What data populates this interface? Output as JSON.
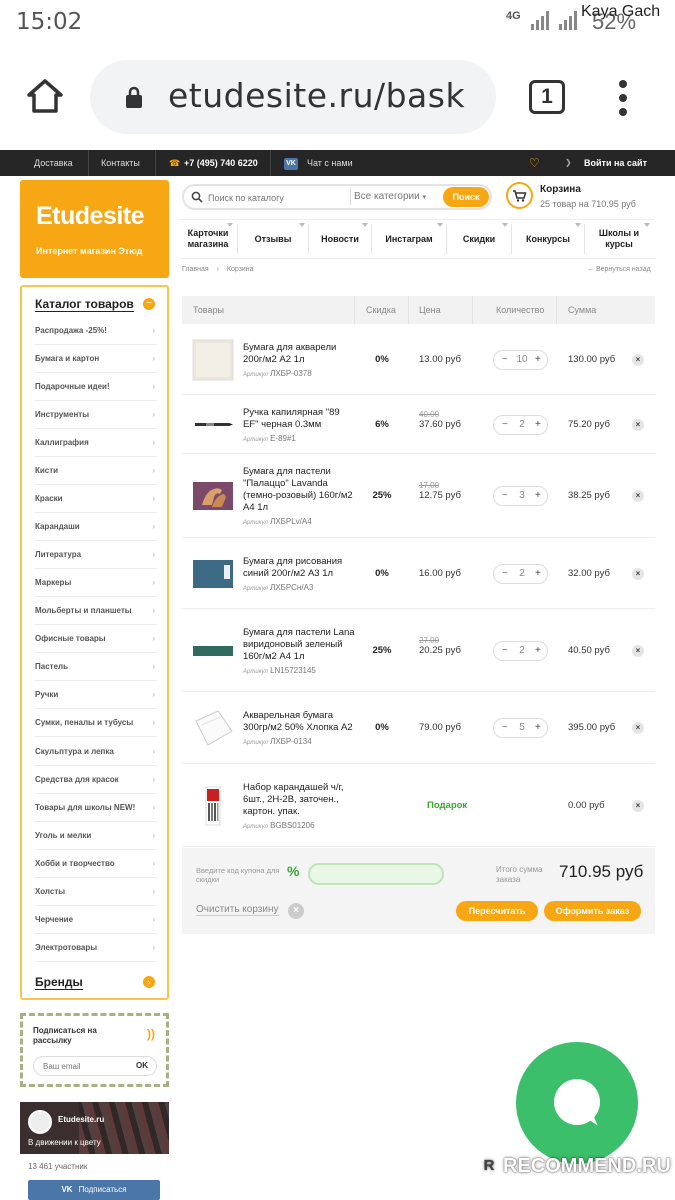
{
  "status": {
    "time": "15:02",
    "network": "4G",
    "battery": "52%",
    "watermark_user": "Kaya Gach"
  },
  "browser": {
    "url": "etudesite.ru/bask",
    "tab_count": "1"
  },
  "topbar": {
    "delivery": "Доставка",
    "contacts": "Контакты",
    "phone": "+7 (495) 740 6220",
    "vk": "VK",
    "chat": "Чат с нами",
    "login": "Войти на сайт"
  },
  "logo": {
    "brand": "Etudesite",
    "tagline": "Интернет магазин Этюд"
  },
  "search": {
    "placeholder": "Поиск по каталогу",
    "category": "Все категории",
    "button": "Поиск"
  },
  "cart": {
    "title": "Корзина",
    "summary": "25 товар на 710.95 руб"
  },
  "nav": [
    "Карточки магазина",
    "Отзывы",
    "Новости",
    "Инстаграм",
    "Скидки",
    "Конкурсы",
    "Школы и курсы"
  ],
  "breadcrumb": {
    "home": "Главная",
    "sep": "›",
    "current": "Корзина",
    "back": "← Вернуться назад"
  },
  "catalog": {
    "title": "Каталог товаров",
    "items": [
      "Распродажа -25%!",
      "Бумага и картон",
      "Подарочные идеи!",
      "Инструменты",
      "Каллиграфия",
      "Кисти",
      "Краски",
      "Карандаши",
      "Литература",
      "Маркеры",
      "Мольберты и планшеты",
      "Офисные товары",
      "Пастель",
      "Ручки",
      "Сумки, пеналы и тубусы",
      "Скульптура и лепка",
      "Средства для красок",
      "Товары для школы NEW!",
      "Уголь и мелки",
      "Хобби и творчество",
      "Холсты",
      "Черчение",
      "Электротовары"
    ],
    "brands": "Бренды"
  },
  "newsletter": {
    "title": "Подписаться на рассылку",
    "placeholder": "Ваш email",
    "ok": "OK"
  },
  "vk_widget": {
    "name": "Etudesite.ru",
    "motto": "В движении к цвету",
    "members": "13 461 участник",
    "subscribe": "Подписаться"
  },
  "table": {
    "headers": {
      "goods": "Товары",
      "discount": "Скидка",
      "price": "Цена",
      "qty": "Количество",
      "sum": "Сумма"
    },
    "rows": [
      {
        "name": "Бумага для акварели 200г/м2 А2 1л",
        "article_label": "Артикул",
        "article": "ЛХБР-0378",
        "discount": "0%",
        "old": "",
        "price": "13.00 руб",
        "qty": "10",
        "sum": "130.00 руб",
        "thumb": "paper-sheet-icon"
      },
      {
        "name": "Ручка капилярная \"89 EF\" черная 0.3мм",
        "article_label": "Артикул",
        "article": "Е-89#1",
        "discount": "6%",
        "old": "40.00",
        "price": "37.60 руб",
        "qty": "2",
        "sum": "75.20 руб",
        "thumb": "pen-icon"
      },
      {
        "name": "Бумага для пастели \"Палаццо\" Lavanda (темно-розовый) 160г/м2 А4 1л",
        "article_label": "Артикул",
        "article": "ЛХБРLv/A4",
        "discount": "25%",
        "old": "17.00",
        "price": "12.75 руб",
        "qty": "3",
        "sum": "38.25 руб",
        "thumb": "horse-print-icon"
      },
      {
        "name": "Бумага для рисования синий 200г/м2 А3 1л",
        "article_label": "Артикул",
        "article": "ЛХБРСн/А3",
        "discount": "0%",
        "old": "",
        "price": "16.00 руб",
        "qty": "2",
        "sum": "32.00 руб",
        "thumb": "blue-paper-icon"
      },
      {
        "name": "Бумага для пастели Lana виридоновый зеленый 160г/м2 А4 1л",
        "article_label": "Артикул",
        "article": "LN15723145",
        "discount": "25%",
        "old": "27.00",
        "price": "20.25 руб",
        "qty": "2",
        "sum": "40.50 руб",
        "thumb": "green-paper-icon"
      },
      {
        "name": "Акварельная бумага 300гр/м2 50% Хлопка А2",
        "article_label": "Артикул",
        "article": "ЛХБР-0134",
        "discount": "0%",
        "old": "",
        "price": "79.00 руб",
        "qty": "5",
        "sum": "395.00 руб",
        "thumb": "white-paper-icon"
      },
      {
        "name": "Набор карандашей ч/г, 6шт., 2Н-2В, заточен., картон. упак.",
        "article_label": "Артикул",
        "article": "BGBS01206",
        "gift": "Подарок",
        "sum": "0.00 руб",
        "thumb": "pencil-set-icon"
      }
    ]
  },
  "footer": {
    "coupon_label": "Введите код купона для скидки",
    "pct": "%",
    "total_label": "Итого сумма заказа",
    "total": "710.95 руб",
    "clear": "Очистить корзину",
    "recalc": "Пересчитать",
    "checkout": "Оформить заказ"
  },
  "overlay": {
    "watermark": "RECOMMEND.RU"
  },
  "colors": {
    "accent": "#f8a714",
    "topbar": "#262626",
    "green": "#3aa935",
    "chat": "#3cbf6a",
    "vk": "#4a76a8"
  }
}
